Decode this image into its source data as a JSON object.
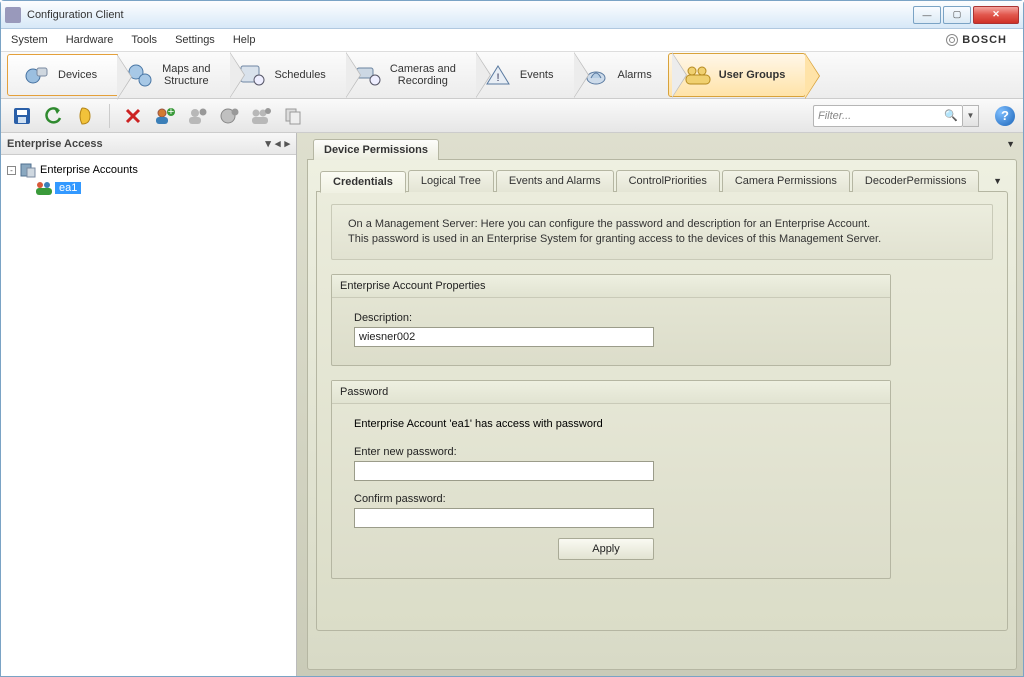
{
  "window": {
    "title": "Configuration Client"
  },
  "menu": {
    "system": "System",
    "hardware": "Hardware",
    "tools": "Tools",
    "settings": "Settings",
    "help": "Help"
  },
  "brand": "BOSCH",
  "nav": {
    "devices": "Devices",
    "maps": "Maps and\nStructure",
    "schedules": "Schedules",
    "cameras": "Cameras and\nRecording",
    "events": "Events",
    "alarms": "Alarms",
    "usergroups": "User Groups"
  },
  "filter": {
    "placeholder": "Filter..."
  },
  "left": {
    "title": "Enterprise Access",
    "root": "Enterprise Accounts",
    "child": "ea1"
  },
  "right": {
    "devicePermissions": "Device Permissions",
    "tabs": {
      "credentials": "Credentials",
      "logical": "Logical Tree",
      "events": "Events and Alarms",
      "control": "ControlPriorities",
      "camera": "Camera Permissions",
      "decoder": "DecoderPermissions"
    },
    "info1": "On a Management Server: Here you can configure the password and description for an Enterprise Account.",
    "info2": "This password is used in an Enterprise System for granting access to the devices of this Management Server.",
    "group1": {
      "title": "Enterprise Account Properties",
      "desc_label": "Description:",
      "desc_value": "wiesner002"
    },
    "group2": {
      "title": "Password",
      "status": "Enterprise Account 'ea1' has access with password",
      "new_label": "Enter new password:",
      "confirm_label": "Confirm password:",
      "apply": "Apply"
    }
  }
}
